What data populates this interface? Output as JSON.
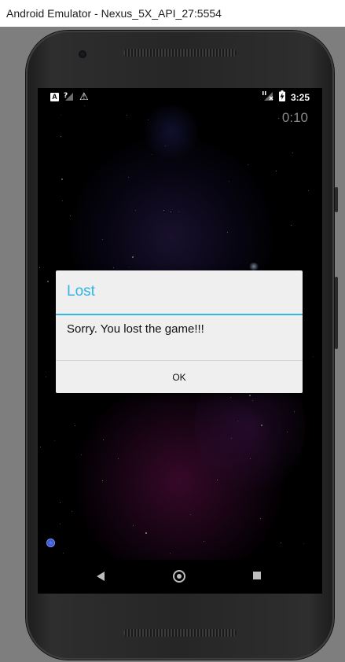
{
  "window": {
    "title": "Android Emulator - Nexus_5X_API_27:5554"
  },
  "status_bar": {
    "left_icons": [
      "a-icon",
      "no-signal-icon",
      "warning-icon"
    ],
    "a_glyph": "A",
    "warning_glyph": "⚠",
    "right_icons": [
      "lte-no-signal-icon",
      "battery-charging-icon"
    ],
    "clock": "3:25"
  },
  "game": {
    "timer": "0:10"
  },
  "dialog": {
    "title": "Lost",
    "message": "Sorry. You lost the game!!!",
    "ok_label": "OK",
    "accent_color": "#33b5e5"
  },
  "nav_bar": {
    "icons": [
      "back-icon",
      "home-icon",
      "recent-apps-icon"
    ]
  }
}
